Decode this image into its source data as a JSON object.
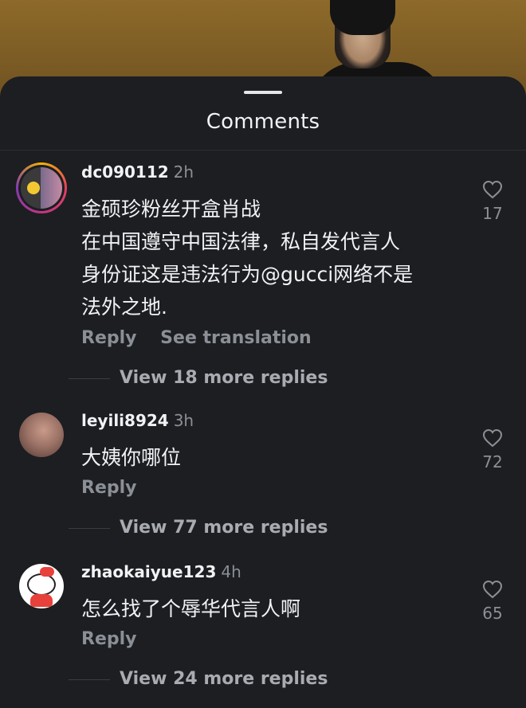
{
  "sheet": {
    "title": "Comments"
  },
  "comments": [
    {
      "username": "dc090112",
      "time": "2h",
      "lines": [
        "金硕珍粉丝开盒肖战",
        "在中国遵守中国法律，私自发代言人",
        "身份证这是违法行为@gucci网络不是",
        "法外之地."
      ],
      "reply_label": "Reply",
      "translate_label": "See translation",
      "likes": "17",
      "view_more": "View 18 more replies"
    },
    {
      "username": "leyili8924",
      "time": "3h",
      "lines": [
        "大姨你哪位"
      ],
      "reply_label": "Reply",
      "likes": "72",
      "view_more": "View 77 more replies"
    },
    {
      "username": "zhaokaiyue123",
      "time": "4h",
      "lines": [
        "怎么找了个辱华代言人啊"
      ],
      "reply_label": "Reply",
      "likes": "65",
      "view_more": "View 24 more replies"
    }
  ],
  "icons": {
    "like": "heart-outline-icon"
  },
  "colors": {
    "background": "#1c1e21",
    "text": "#f1f2f4",
    "muted": "#8b8f96"
  }
}
